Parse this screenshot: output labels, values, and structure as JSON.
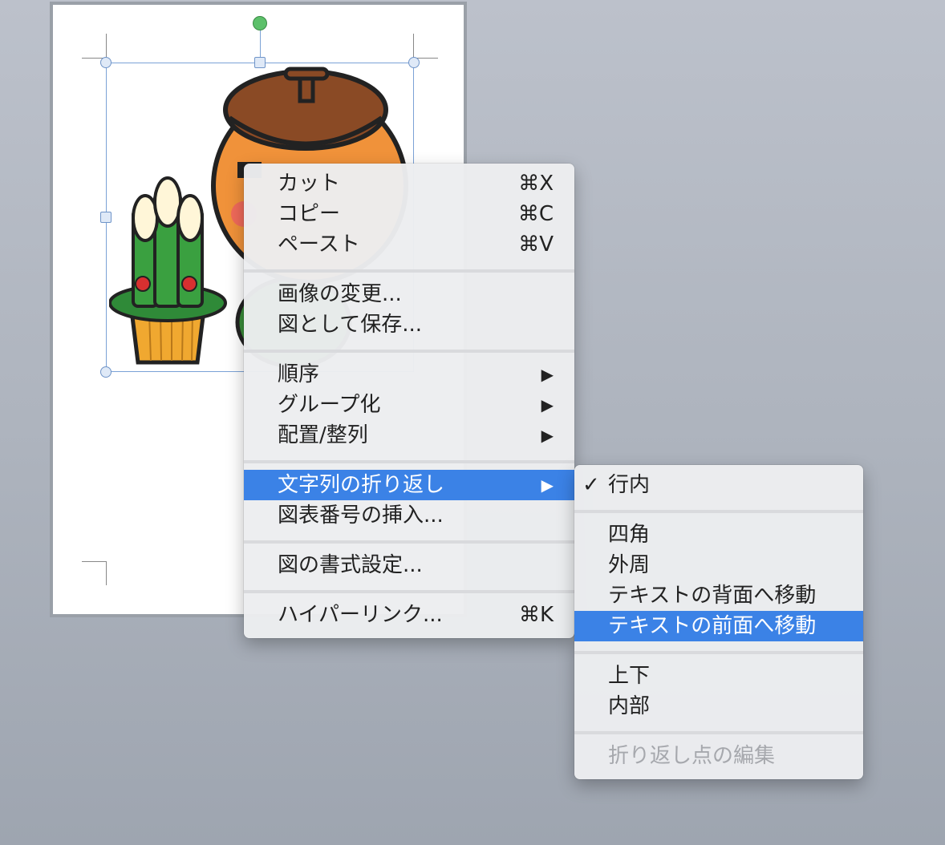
{
  "context_menu": {
    "items": [
      {
        "label": "カット",
        "shortcut": "⌘X"
      },
      {
        "label": "コピー",
        "shortcut": "⌘C"
      },
      {
        "label": "ペースト",
        "shortcut": "⌘V"
      },
      {
        "label": "画像の変更..."
      },
      {
        "label": "図として保存..."
      },
      {
        "label": "順序",
        "arrow": "▶"
      },
      {
        "label": "グループ化",
        "arrow": "▶"
      },
      {
        "label": "配置/整列",
        "arrow": "▶"
      },
      {
        "label": "文字列の折り返し",
        "arrow": "▶"
      },
      {
        "label": "図表番号の挿入..."
      },
      {
        "label": "図の書式設定..."
      },
      {
        "label": "ハイパーリンク...",
        "shortcut": "⌘K"
      }
    ]
  },
  "submenu": {
    "checkmark": "✓",
    "items": [
      {
        "label": "行内"
      },
      {
        "label": "四角"
      },
      {
        "label": "外周"
      },
      {
        "label": "テキストの背面へ移動"
      },
      {
        "label": "テキストの前面へ移動"
      },
      {
        "label": "上下"
      },
      {
        "label": "内部"
      },
      {
        "label": "折り返し点の編集"
      }
    ]
  },
  "colors": {
    "highlight": "#3b82e6",
    "menu_bg": "#ecedf0",
    "disabled_text": "#a6a8ad",
    "selection_handle": "#6f94c8",
    "rotation_handle": "#5cc06a"
  }
}
